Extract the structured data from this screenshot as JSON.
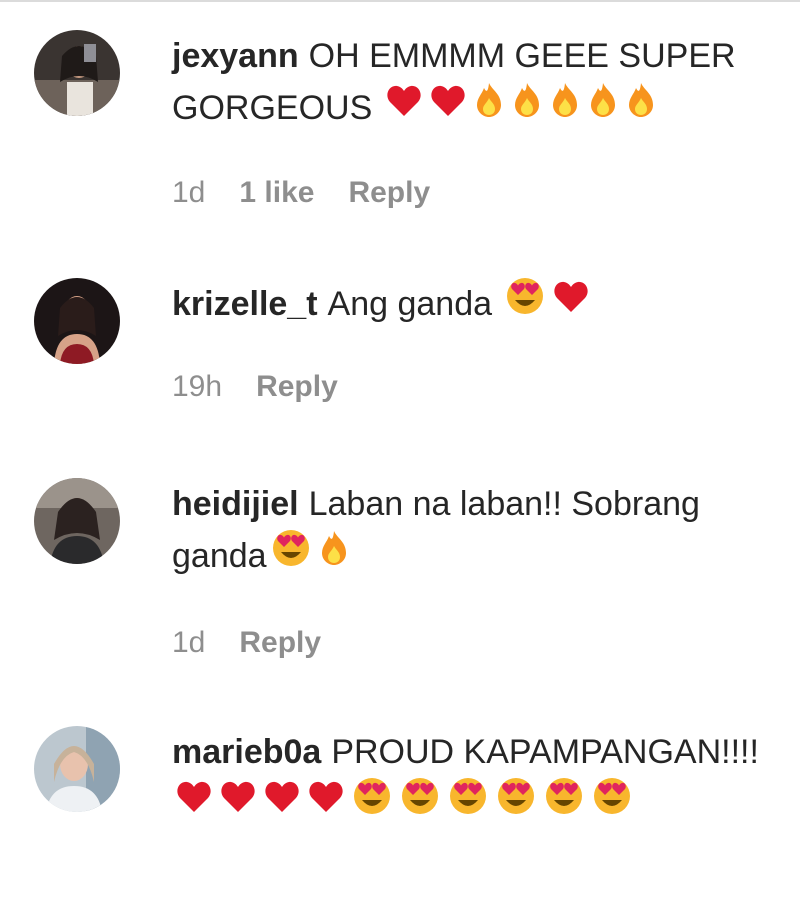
{
  "comments": [
    {
      "username": "jexyann",
      "text": "OH EMMMM GEEE SUPER GORGEOUS",
      "emojis": [
        "red-heart",
        "red-heart",
        "fire",
        "fire",
        "fire",
        "fire",
        "fire"
      ],
      "time": "1d",
      "likes": "1 like",
      "reply": "Reply"
    },
    {
      "username": "krizelle_t",
      "text": "Ang ganda",
      "emojis": [
        "heart-eyes",
        "red-heart"
      ],
      "time": "19h",
      "likes": "",
      "reply": "Reply"
    },
    {
      "username": "heidijiel",
      "text": "Laban na laban!! Sobrang ganda",
      "emojis": [
        "heart-eyes",
        "fire"
      ],
      "time": "1d",
      "likes": "",
      "reply": "Reply"
    },
    {
      "username": "marieb0a",
      "text": "PROUD KAPAMPANGAN!!!!",
      "emojis": [
        "red-heart",
        "red-heart",
        "red-heart",
        "red-heart",
        "heart-eyes",
        "heart-eyes",
        "heart-eyes",
        "heart-eyes",
        "heart-eyes",
        "heart-eyes"
      ],
      "time": "",
      "likes": "",
      "reply": ""
    }
  ],
  "colors": {
    "text": "#262626",
    "meta": "#8e8e8e",
    "heart": "#e0192b",
    "fire": "#f7941d",
    "face": "#f8b62d"
  }
}
